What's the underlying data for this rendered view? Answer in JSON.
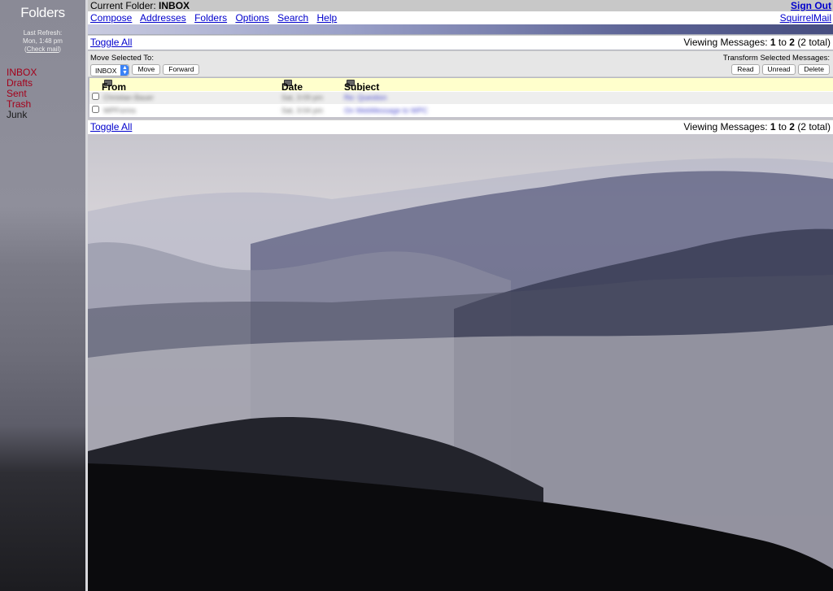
{
  "sidebar": {
    "title": "Folders",
    "last_refresh_label": "Last Refresh:",
    "last_refresh_time": "Mon, 1:48 pm",
    "check_mail": "Check mail",
    "folders": [
      {
        "label": "INBOX"
      },
      {
        "label": "Drafts"
      },
      {
        "label": "Sent"
      },
      {
        "label": "Trash"
      },
      {
        "label": "Junk"
      }
    ]
  },
  "header": {
    "current_folder_label": "Current Folder:",
    "current_folder": "INBOX",
    "sign_out": "Sign Out",
    "brand": "SquirrelMail",
    "nav": [
      "Compose",
      "Addresses",
      "Folders",
      "Options",
      "Search",
      "Help"
    ]
  },
  "toolbar": {
    "toggle_all": "Toggle All",
    "viewing_prefix": "Viewing Messages:",
    "viewing_from": "1",
    "viewing_to_word": "to",
    "viewing_to": "2",
    "viewing_total": "(2 total)",
    "move_selected_to": "Move Selected To:",
    "transform_selected": "Transform Selected Messages:",
    "folder_select": "INBOX",
    "move_button": "Move",
    "forward_button": "Forward",
    "read_button": "Read",
    "unread_button": "Unread",
    "delete_button": "Delete"
  },
  "table": {
    "columns": [
      "From",
      "Date",
      "Subject"
    ],
    "rows": [
      {
        "from": "Christian Bauer",
        "date": "Sat, 3:09 pm",
        "subject": "Re: Question"
      },
      {
        "from": "WPForms",
        "date": "Sat, 3:04 pm",
        "subject": "On WebMessage to WPC"
      }
    ]
  },
  "colors": {
    "link": "#0000cc",
    "folder_red": "#a4001a",
    "table_header": "#ffffcc",
    "accent_bar_end": "#474e80"
  }
}
